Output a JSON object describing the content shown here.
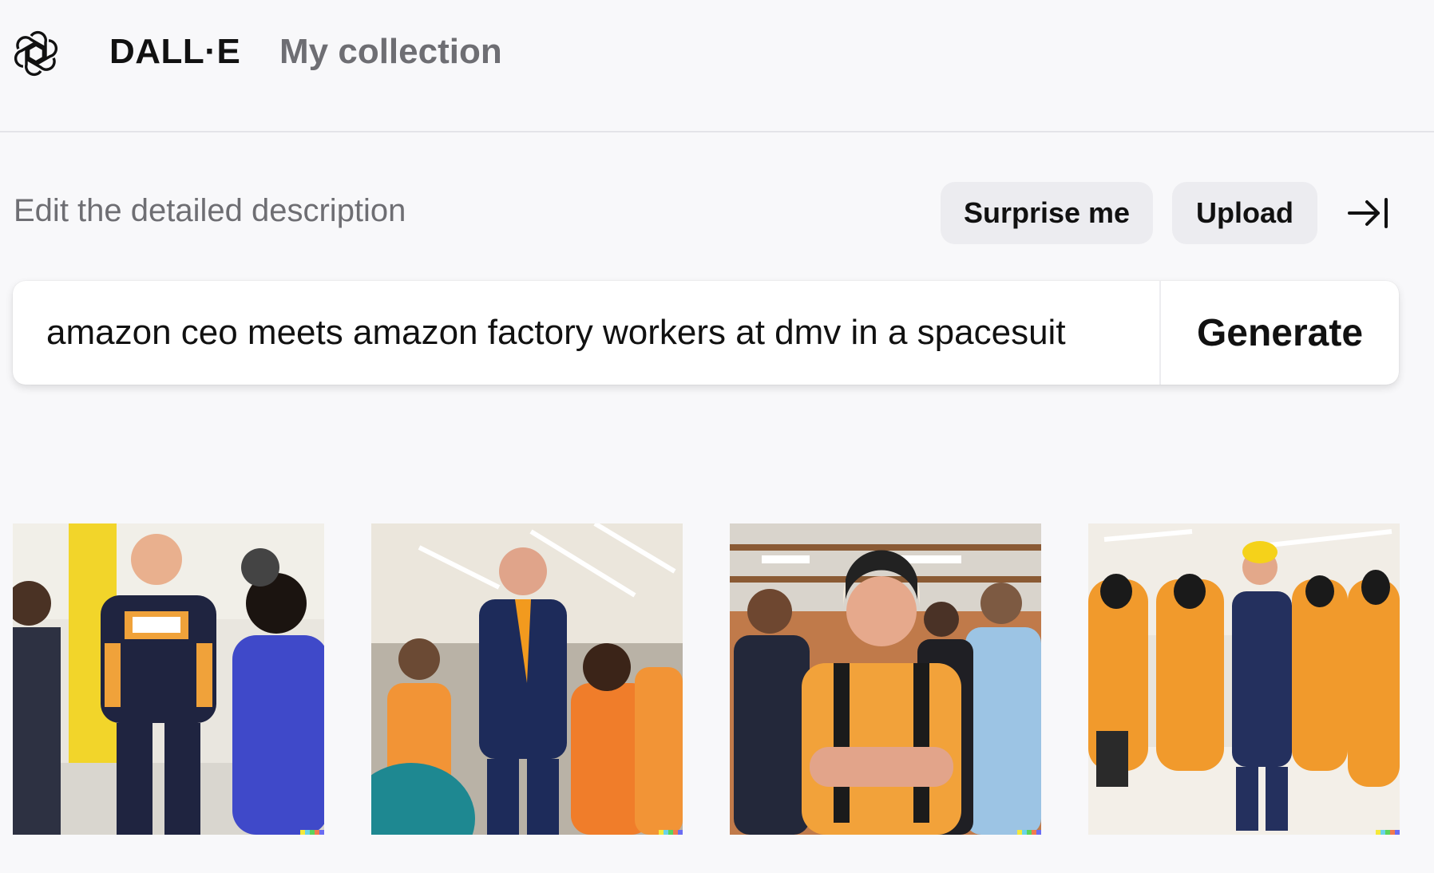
{
  "header": {
    "logo_icon": "openai-logo-icon",
    "brand": "DALL·E",
    "nav_collection": "My collection"
  },
  "toolbar": {
    "edit_label": "Edit the detailed description",
    "surprise_label": "Surprise me",
    "upload_label": "Upload",
    "collapse_icon": "arrow-right-to-bar-icon"
  },
  "prompt": {
    "value": "amazon ceo meets amazon factory workers at dmv in a spacesuit",
    "generate_label": "Generate"
  },
  "results": {
    "images": [
      {
        "icon": "generated-image-1"
      },
      {
        "icon": "generated-image-2"
      },
      {
        "icon": "generated-image-3"
      },
      {
        "icon": "generated-image-4"
      }
    ],
    "watermark_colors": [
      "#f5e93a",
      "#6ad3e8",
      "#5bd45b",
      "#f27a4e",
      "#6b6cf2"
    ]
  },
  "colors": {
    "background": "#f8f8fa",
    "button_bg": "#ececf0",
    "muted_text": "#6e6e73",
    "worker_orange": "#f59a2c"
  }
}
